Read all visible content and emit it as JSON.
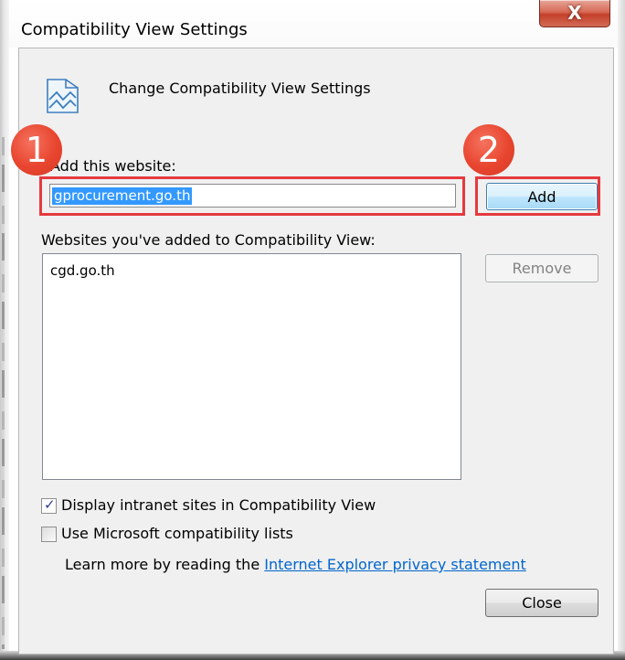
{
  "window": {
    "title": "Compatibility View Settings",
    "close_glyph": "X"
  },
  "header": {
    "icon": "compatibility-view-icon",
    "text": "Change Compatibility View Settings"
  },
  "add_section": {
    "label": "Add this website:",
    "input_value": "gprocurement.go.th",
    "add_button": "Add"
  },
  "websites_section": {
    "label": "Websites you've added to Compatibility View:",
    "items": [
      "cgd.go.th"
    ],
    "remove_button": "Remove"
  },
  "options": {
    "intranet": {
      "label": "Display intranet sites in Compatibility View",
      "checked": true
    },
    "ms_lists": {
      "label": "Use Microsoft compatibility lists",
      "checked": false
    }
  },
  "learn_more": {
    "prefix": "Learn more by reading the ",
    "link": "Internet Explorer privacy statement"
  },
  "close_button": "Close",
  "annotations": {
    "step1": "1",
    "step2": "2",
    "color": "#e53a3f"
  }
}
